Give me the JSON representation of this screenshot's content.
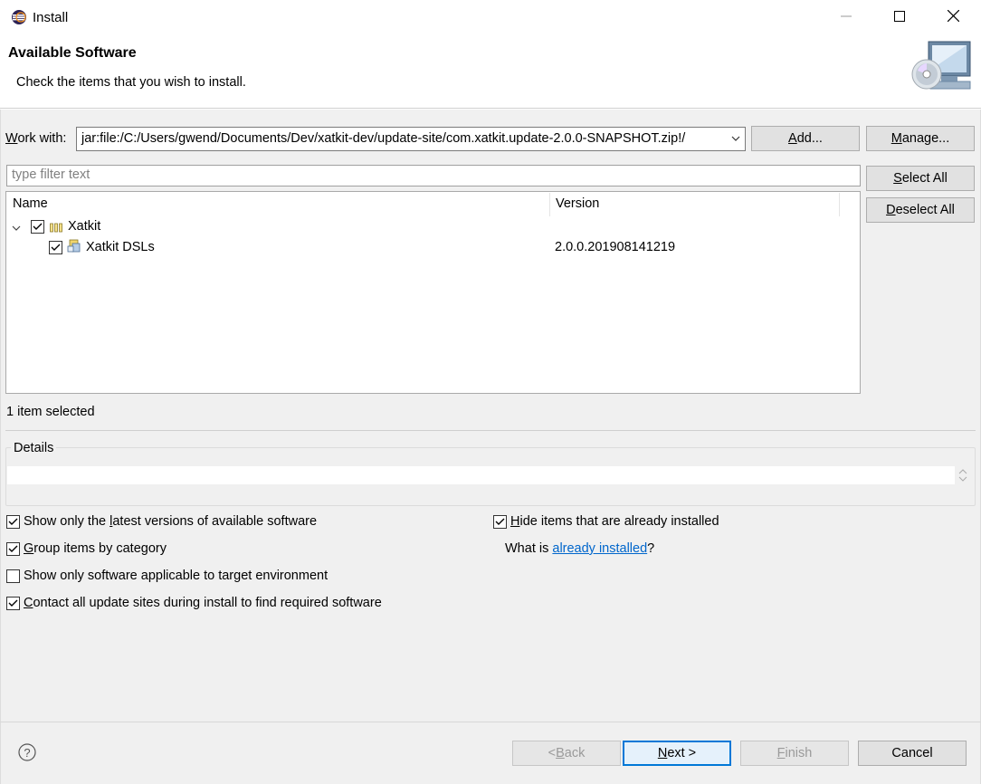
{
  "window": {
    "title": "Install"
  },
  "header": {
    "title": "Available Software",
    "description": "Check the items that you wish to install."
  },
  "work_with": {
    "label_mnemonic": "W",
    "label_rest": "ork with:",
    "value": "jar:file:/C:/Users/gwend/Documents/Dev/xatkit-dev/update-site/com.xatkit.update-2.0.0-SNAPSHOT.zip!/",
    "add_mnemonic": "A",
    "add_rest": "dd...",
    "manage_mnemonic": "M",
    "manage_rest": "anage..."
  },
  "filter": {
    "placeholder": "type filter text"
  },
  "select_all": {
    "mnemonic": "S",
    "rest": "elect All"
  },
  "deselect_all": {
    "mnemonic": "D",
    "rest": "eselect All"
  },
  "tree": {
    "columns": [
      "Name",
      "Version"
    ],
    "rows": [
      {
        "name": "Xatkit",
        "version": "",
        "checked": true,
        "expanded": true
      },
      {
        "name": "Xatkit DSLs",
        "version": "2.0.0.201908141219",
        "checked": true
      }
    ]
  },
  "selection_status": "1 item selected",
  "details": {
    "label": "Details"
  },
  "options": {
    "latest_before": "Show only the ",
    "latest_mnemonic": "l",
    "latest_after": "atest versions of available software",
    "latest_checked": true,
    "group_mnemonic": "G",
    "group_rest": "roup items by category",
    "group_checked": true,
    "applicable": "Show only software applicable to target environment",
    "applicable_checked": false,
    "contact_mnemonic": "C",
    "contact_rest": "ontact all update sites during install to find required software",
    "contact_checked": true,
    "hide_mnemonic": "H",
    "hide_rest": "ide items that are already installed",
    "hide_checked": true,
    "what_is": "What is ",
    "already_installed_link": "already installed",
    "question": "?"
  },
  "footer": {
    "back_pre": "< ",
    "back_mnemonic": "B",
    "back_rest": "ack",
    "next_mnemonic": "N",
    "next_rest": "ext >",
    "finish_mnemonic": "F",
    "finish_rest": "inish",
    "cancel": "Cancel"
  },
  "icons": {
    "app": "eclipse-icon",
    "minimize": "minimize-icon",
    "maximize": "maximize-icon",
    "close": "close-icon",
    "help": "help-icon",
    "header": "install-cd-monitor-icon",
    "category": "category-icon",
    "feature": "feature-plugin-icon"
  },
  "colors": {
    "accent": "#0078d7",
    "link": "#0066cc"
  }
}
